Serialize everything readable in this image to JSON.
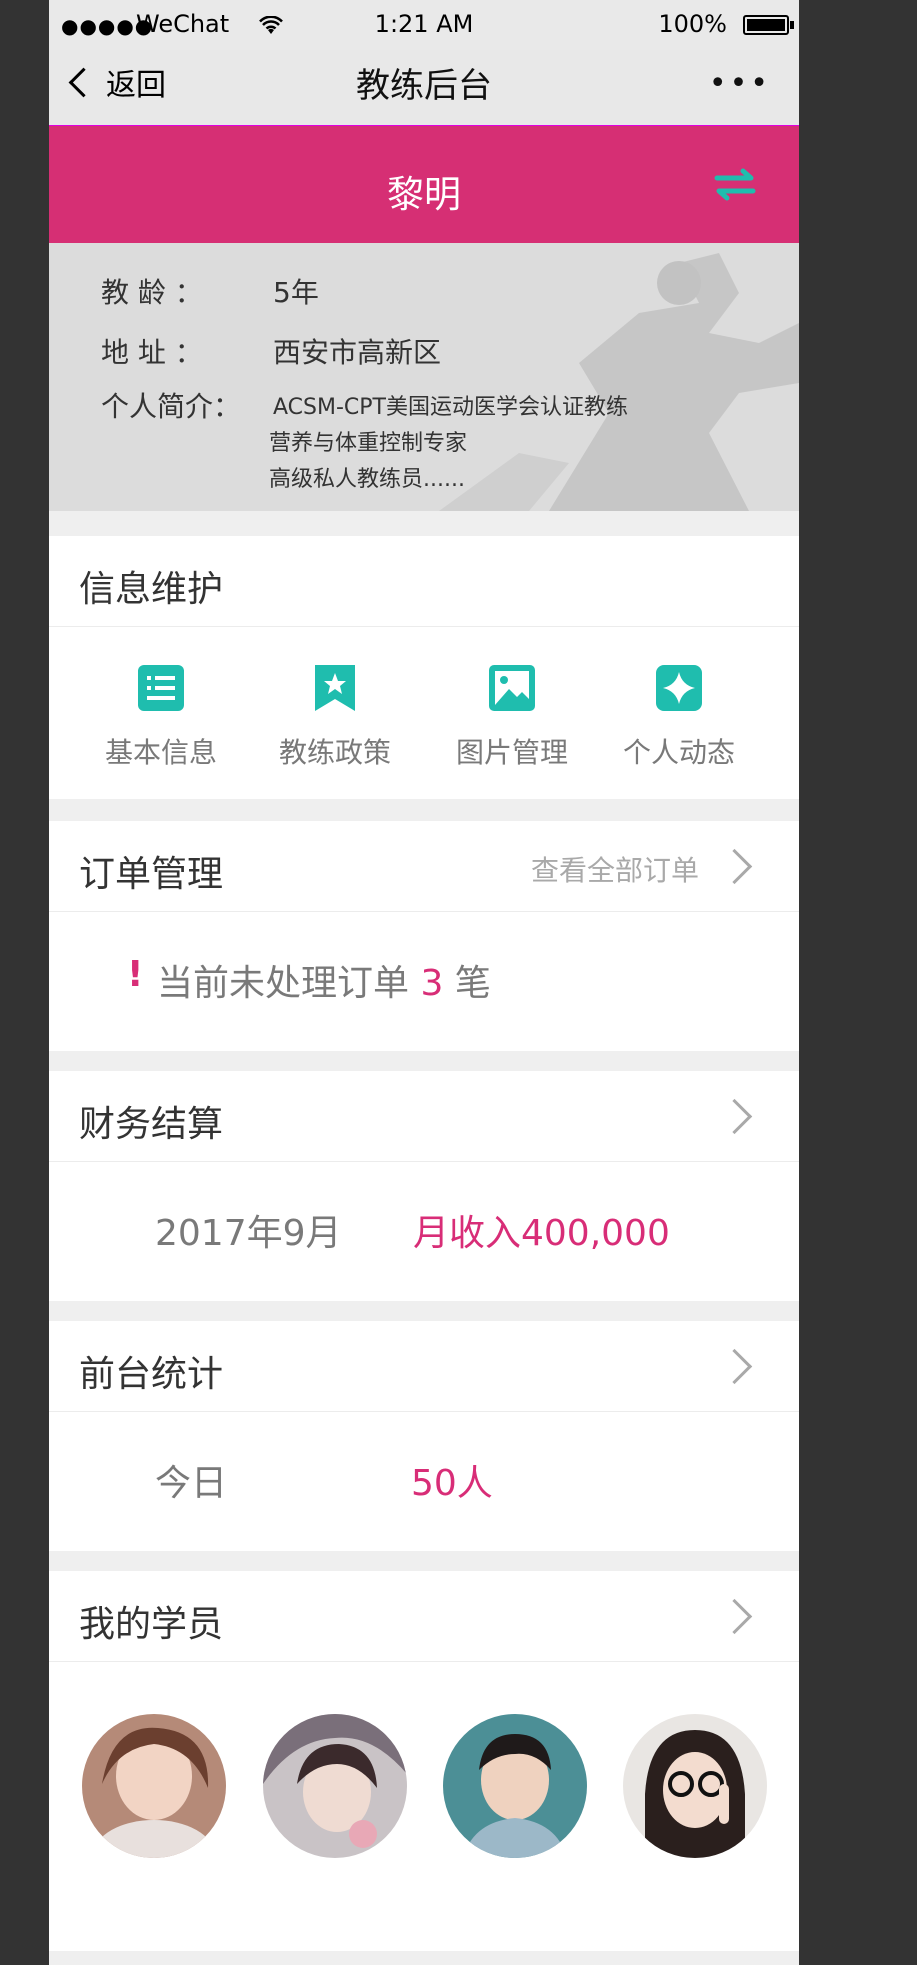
{
  "status_bar": {
    "signal": "●●●●●",
    "carrier": "WeChat",
    "time": "1:21 AM",
    "battery": "100%"
  },
  "nav": {
    "back_label": "返回",
    "title": "教练后台",
    "more": "•••"
  },
  "coach": {
    "name": "黎明",
    "teaching_years_label": "教  龄  ：",
    "teaching_years": "5年",
    "address_label": "地  址  ：",
    "address": "西安市高新区",
    "bio_label": "个人简介：",
    "bio_lines": [
      "ACSM-CPT美国运动医学会认证教练",
      "营养与体重控制专家",
      "高级私人教练员......"
    ]
  },
  "info": {
    "title": "信息维护",
    "items": [
      {
        "label": "基本信息",
        "icon": "form-icon"
      },
      {
        "label": "教练政策",
        "icon": "bookmark-icon"
      },
      {
        "label": "图片管理",
        "icon": "image-icon"
      },
      {
        "label": "个人动态",
        "icon": "sparkle-icon"
      }
    ]
  },
  "orders": {
    "title": "订单管理",
    "view_all": "查看全部订单",
    "pending_prefix": "当前未处理订单",
    "pending_count": "3",
    "pending_suffix": "笔",
    "alert": "!"
  },
  "finance": {
    "title": "财务结算",
    "period": "2017年9月",
    "income": "月收入400,000"
  },
  "frontdesk": {
    "title": "前台统计",
    "label": "今日",
    "value": "50人"
  },
  "students": {
    "title": "我的学员",
    "count": 4
  },
  "colors": {
    "accent": "#d62f74",
    "teal": "#1fbdae",
    "text": "#333333",
    "muted": "#797979",
    "light": "#a9a9a9"
  }
}
